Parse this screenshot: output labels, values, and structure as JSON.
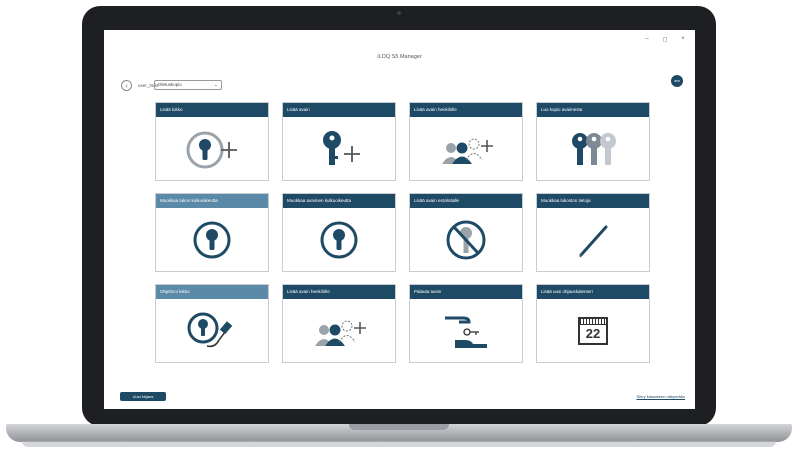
{
  "app": {
    "title": "iLOQ S5 Manager",
    "window_controls": [
      "–",
      "◻",
      "×"
    ]
  },
  "header": {
    "user_label": "user_3rd4",
    "select_value": "Oletuskopio",
    "avatar_initials": "am"
  },
  "tiles": [
    {
      "label": "Lisää lukko",
      "icon": "lock-plus-icon"
    },
    {
      "label": "Lisää avain",
      "icon": "key-plus-icon"
    },
    {
      "label": "Lisää avain henkilölle",
      "icon": "persons-plus-icon"
    },
    {
      "label": "Luo kopio avaimesta",
      "icon": "three-keys-icon"
    },
    {
      "label": "Muokkaa lukon kulkuoikeutta",
      "icon": "lock-icon"
    },
    {
      "label": "Muokkaa avaimen kulkuoikeutta",
      "icon": "lock-icon"
    },
    {
      "label": "Lisää avain estolistalle",
      "icon": "key-blocked-icon"
    },
    {
      "label": "Muokkaa lukoston tietoja",
      "icon": "pen-icon"
    },
    {
      "label": "Ohjelmoi lukko",
      "icon": "lock-usb-icon"
    },
    {
      "label": "Lisää avain henkilölle",
      "icon": "persons-plus-icon"
    },
    {
      "label": "Palauta avain",
      "icon": "hand-key-icon"
    },
    {
      "label": "Lisää uusi ohjauskalenteri",
      "icon": "calendar-icon"
    }
  ],
  "calendar_day": "22",
  "footer": {
    "primary_button": "Uusi kirjaus",
    "link": "Siirry klassiseen näkymään"
  },
  "colors": {
    "tile_header": "#1f4a66",
    "tile_header_light": "#5b8aa8",
    "icon_dark": "#1f4a66",
    "icon_gray": "#9aa3aa"
  }
}
